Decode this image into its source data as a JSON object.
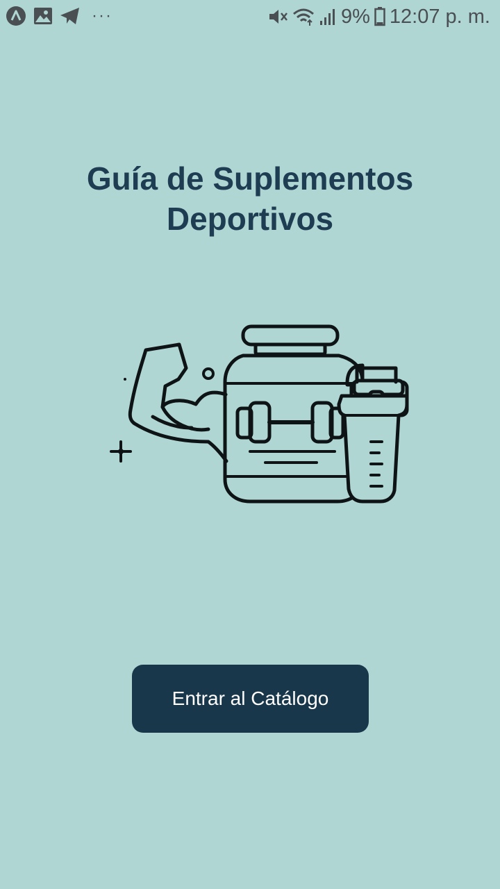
{
  "status_bar": {
    "left_icons": [
      "app-a-icon",
      "gallery-icon",
      "telegram-icon",
      "more-dots-icon"
    ],
    "more_text": "···",
    "right_icons": [
      "mute-icon",
      "wifi-icon",
      "signal-icon",
      "battery-icon"
    ],
    "battery_text": "9%",
    "time_text": "12:07 p. m."
  },
  "main": {
    "title_line1": "Guía de Suplementos",
    "title_line2": "Deportivos",
    "illustration_icon": "supplements-illustration-icon",
    "button_label": "Entrar al Catálogo"
  },
  "colors": {
    "background": "#afd6d3",
    "title": "#1f3d52",
    "button": "#19374b",
    "button_text": "#ffffff"
  }
}
